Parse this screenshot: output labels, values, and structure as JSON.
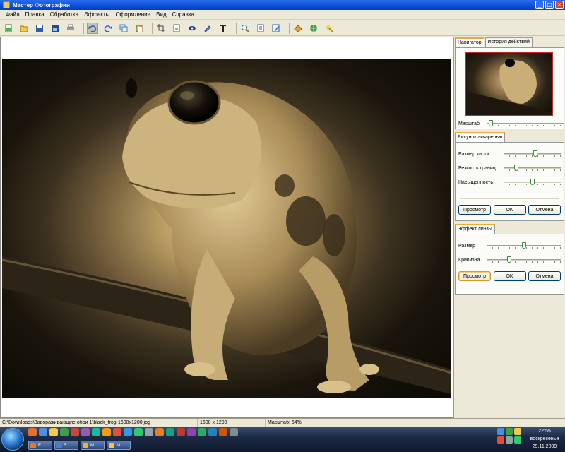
{
  "window": {
    "title": "Мастер Фотографии"
  },
  "menu": [
    "Файл",
    "Правка",
    "Обработка",
    "Эффекты",
    "Оформление",
    "Вид",
    "Справка"
  ],
  "toolbar": {
    "groups": [
      [
        "new-icon",
        "open-icon",
        "save-icon",
        "save-as-icon",
        "print-icon"
      ],
      [
        "undo-icon",
        "redo-icon",
        "copy-icon",
        "paste-icon"
      ],
      [
        "crop-icon",
        "resize-icon",
        "red-eye-icon",
        "brush-icon",
        "text-icon"
      ],
      [
        "zoom-icon",
        "page-icon",
        "edit-icon"
      ],
      [
        "effects-icon",
        "web-icon",
        "help-icon"
      ]
    ]
  },
  "navigator": {
    "tabs": [
      "Навигатор",
      "История действий"
    ],
    "scale_label": "Масштаб",
    "scale_value": 0.05
  },
  "watercolor": {
    "tab": "Рисунок акварелью",
    "sliders": [
      {
        "label": "Размер кисти",
        "value": 0.55
      },
      {
        "label": "Резкость границ",
        "value": 0.22
      },
      {
        "label": "Насыщенность",
        "value": 0.5
      }
    ],
    "buttons": {
      "preview": "Просмотр",
      "ok": "OK",
      "cancel": "Отмена"
    }
  },
  "lens": {
    "tab": "Эффект линзы",
    "sliders": [
      {
        "label": "Размер",
        "value": 0.5
      },
      {
        "label": "Кривизна",
        "value": 0.3
      }
    ],
    "buttons": {
      "preview": "Просмотр",
      "ok": "OK",
      "cancel": "Отмена"
    }
  },
  "status": {
    "path": "C:\\Downloads\\Завораживающие обои 1\\black_frog-1600x1200.jpg",
    "dimensions": "1600 x 1200",
    "zoom": "Масштаб: 64%"
  },
  "taskbar": {
    "tasks": [
      {
        "label": "E",
        "color": "#e8792b"
      },
      {
        "label": "5",
        "color": "#3f7fd6"
      },
      {
        "label": "M",
        "color": "#f0b13a"
      },
      {
        "label": "M",
        "color": "#f5c242"
      }
    ],
    "clock": {
      "time": "22:55",
      "day": "воскресенье",
      "date": "29.11.2009"
    }
  }
}
